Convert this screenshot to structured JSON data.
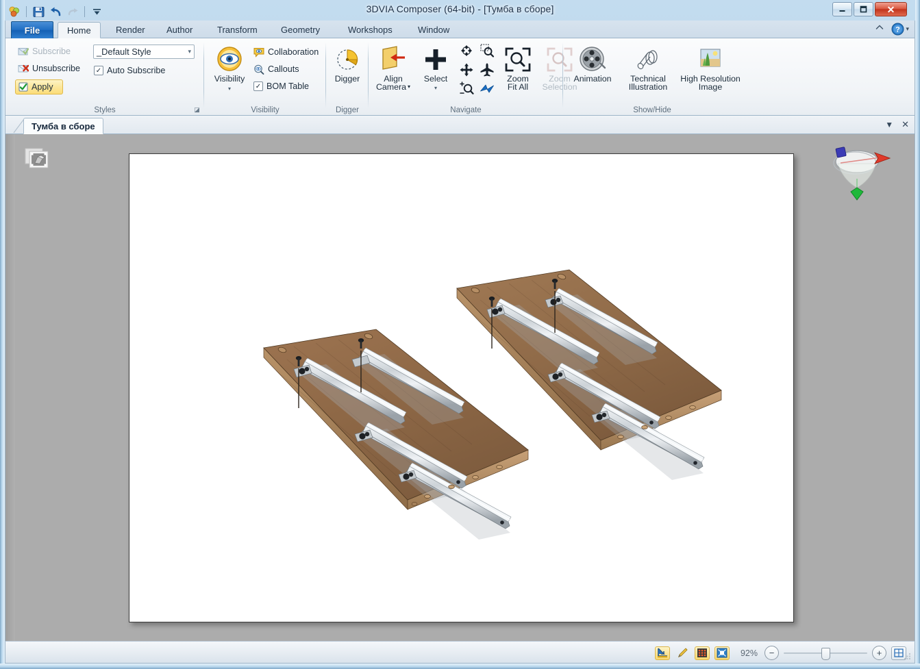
{
  "window": {
    "title": "3DVIA Composer (64-bit) - [Тумба в сборе]",
    "minimize_label": "0",
    "maximize_label": "1",
    "close_label": "✕"
  },
  "quick_access": {
    "items": [
      {
        "name": "app-menu-icon",
        "label": "app"
      },
      {
        "name": "save-icon",
        "label": "Save"
      },
      {
        "name": "undo-icon",
        "label": "Undo"
      },
      {
        "name": "redo-icon",
        "label": "Redo"
      },
      {
        "name": "customize-qat-icon",
        "label": "Customize"
      }
    ]
  },
  "ribbon": {
    "tabs": [
      {
        "label": "File",
        "active": false,
        "file": true
      },
      {
        "label": "Home",
        "active": true,
        "file": false
      },
      {
        "label": "Render",
        "active": false,
        "file": false
      },
      {
        "label": "Author",
        "active": false,
        "file": false
      },
      {
        "label": "Transform",
        "active": false,
        "file": false
      },
      {
        "label": "Geometry",
        "active": false,
        "file": false
      },
      {
        "label": "Workshops",
        "active": false,
        "file": false
      },
      {
        "label": "Window",
        "active": false,
        "file": false
      }
    ],
    "minimize_ribbon_label": "⌃",
    "help_label": "?",
    "help_dropdown_label": "▾",
    "groups": {
      "styles": {
        "title": "Styles",
        "subscribe": "Subscribe",
        "unsubscribe": "Unsubscribe",
        "apply": "Apply",
        "style_value": "_Default Style",
        "style_caret": "▾",
        "auto_subscribe": "Auto Subscribe",
        "auto_subscribe_checked": "✓",
        "dialog_launcher": "◪"
      },
      "visibility": {
        "title": "Visibility",
        "main": "Visibility",
        "main_caret": "▾",
        "collaboration": "Collaboration",
        "callouts": "Callouts",
        "bom_table": "BOM Table",
        "bom_checked": "✓"
      },
      "digger": {
        "title": "Digger",
        "main": "Digger"
      },
      "navigate": {
        "title": "Navigate",
        "align_camera": "Align\nCamera",
        "align_camera_line1": "Align",
        "align_camera_line2": "Camera",
        "align_camera_caret": "▾",
        "select": "Select",
        "select_caret": "▾",
        "zoom_fit_all_line1": "Zoom",
        "zoom_fit_all_line2": "Fit All",
        "zoom_selection_line1": "Zoom",
        "zoom_selection_line2": "Selection",
        "small_tools": [
          {
            "name": "rotate-icon",
            "label": "Rotate"
          },
          {
            "name": "zoom-window-icon",
            "label": "Zoom Window"
          },
          {
            "name": "pan-icon",
            "label": "Pan"
          },
          {
            "name": "fly-icon",
            "label": "Fly"
          },
          {
            "name": "zoom-in-out-icon",
            "label": "Zoom In/Out"
          },
          {
            "name": "walk-icon",
            "label": "Walk"
          }
        ]
      },
      "showhide": {
        "title": "Show/Hide",
        "animation": "Animation",
        "technical_illustration_line1": "Technical",
        "technical_illustration_line2": "Illustration",
        "high_res_image_line1": "High Resolution",
        "high_res_image_line2": "Image"
      }
    }
  },
  "document_tabs": {
    "active_tab": "Тумба в сборе",
    "dropdown_label": "▼",
    "close_label": "✕"
  },
  "workspace": {
    "assembly_thumbnail_name": "assembly-thumbnail",
    "viewport_name": "3d-viewport",
    "compass_name": "view-compass"
  },
  "status_bar": {
    "buttons": [
      {
        "name": "snap-to-grid-button",
        "label": "Snap",
        "on": true
      },
      {
        "name": "paint-tool-button",
        "label": "Paint",
        "on": false
      },
      {
        "name": "grid-button",
        "label": "Grid",
        "on": true
      },
      {
        "name": "fit-view-button",
        "label": "Fit",
        "on": true
      }
    ],
    "zoom_value": "92%",
    "zoom_out_label": "−",
    "zoom_in_label": "+",
    "fit_page_label": "▦"
  },
  "colors": {
    "accent_blue": "#1f6ec4",
    "highlight_yellow": "#fbe599",
    "workarea_gray": "#acacac",
    "wood_light": "#b08a64",
    "wood_dark": "#6e4e33",
    "metal_light": "#e8ecef",
    "metal_dark": "#8d949b"
  }
}
